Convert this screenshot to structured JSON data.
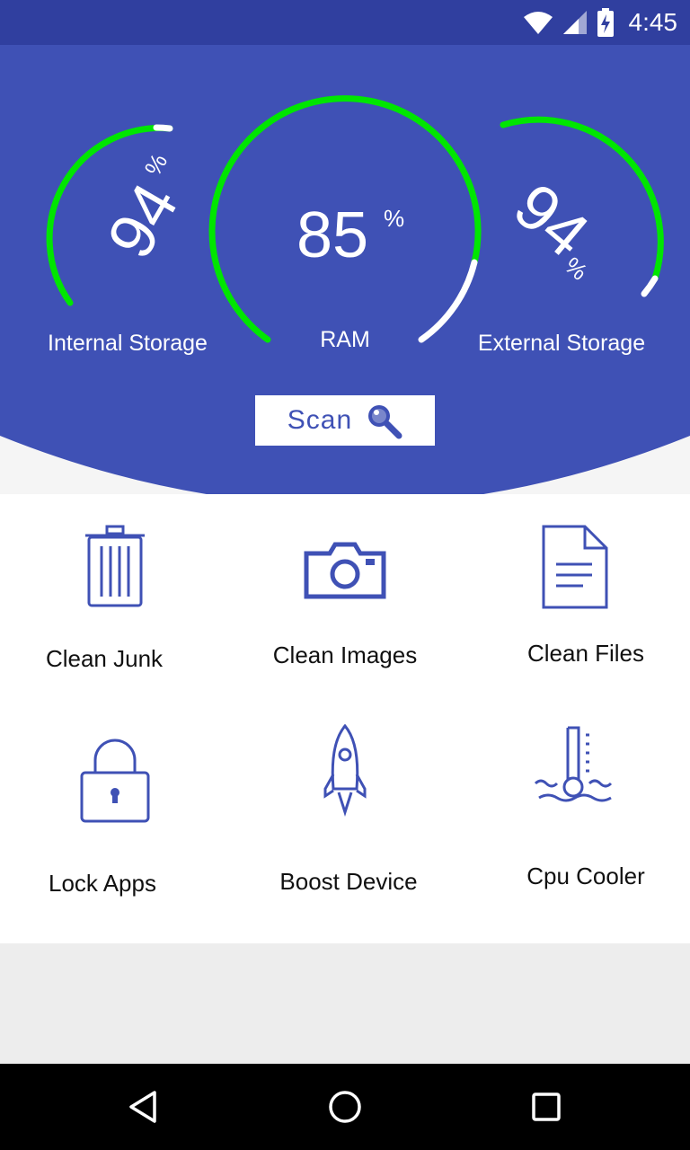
{
  "status_bar": {
    "time": "4:45",
    "icons": [
      "wifi-icon",
      "signal-icon",
      "battery-charging-icon"
    ]
  },
  "gauges": {
    "internal": {
      "value": "94",
      "percent_sign": "%",
      "label": "Internal Storage",
      "fraction": 0.94
    },
    "ram": {
      "value": "85",
      "percent_sign": "%",
      "label": "RAM",
      "fraction": 0.85
    },
    "external": {
      "value": "94",
      "percent_sign": "%",
      "label": "External Storage",
      "fraction": 0.94
    }
  },
  "colors": {
    "primary": "#3f51b5",
    "status_bar": "#303f9f",
    "gauge_fill": "#00e600",
    "gauge_track": "#ffffff",
    "background": "#ededed"
  },
  "scan_button": {
    "label": "Scan",
    "icon": "magnifier-icon"
  },
  "tools": [
    {
      "label": "Clean Junk",
      "icon": "trash-icon"
    },
    {
      "label": "Clean Images",
      "icon": "camera-icon"
    },
    {
      "label": "Clean Files",
      "icon": "document-icon"
    },
    {
      "label": "Lock Apps",
      "icon": "lock-icon"
    },
    {
      "label": "Boost Device",
      "icon": "rocket-icon"
    },
    {
      "label": "Cpu Cooler",
      "icon": "thermometer-icon"
    }
  ],
  "nav_bar": {
    "icons": [
      "back-icon",
      "home-icon",
      "recents-icon"
    ]
  }
}
